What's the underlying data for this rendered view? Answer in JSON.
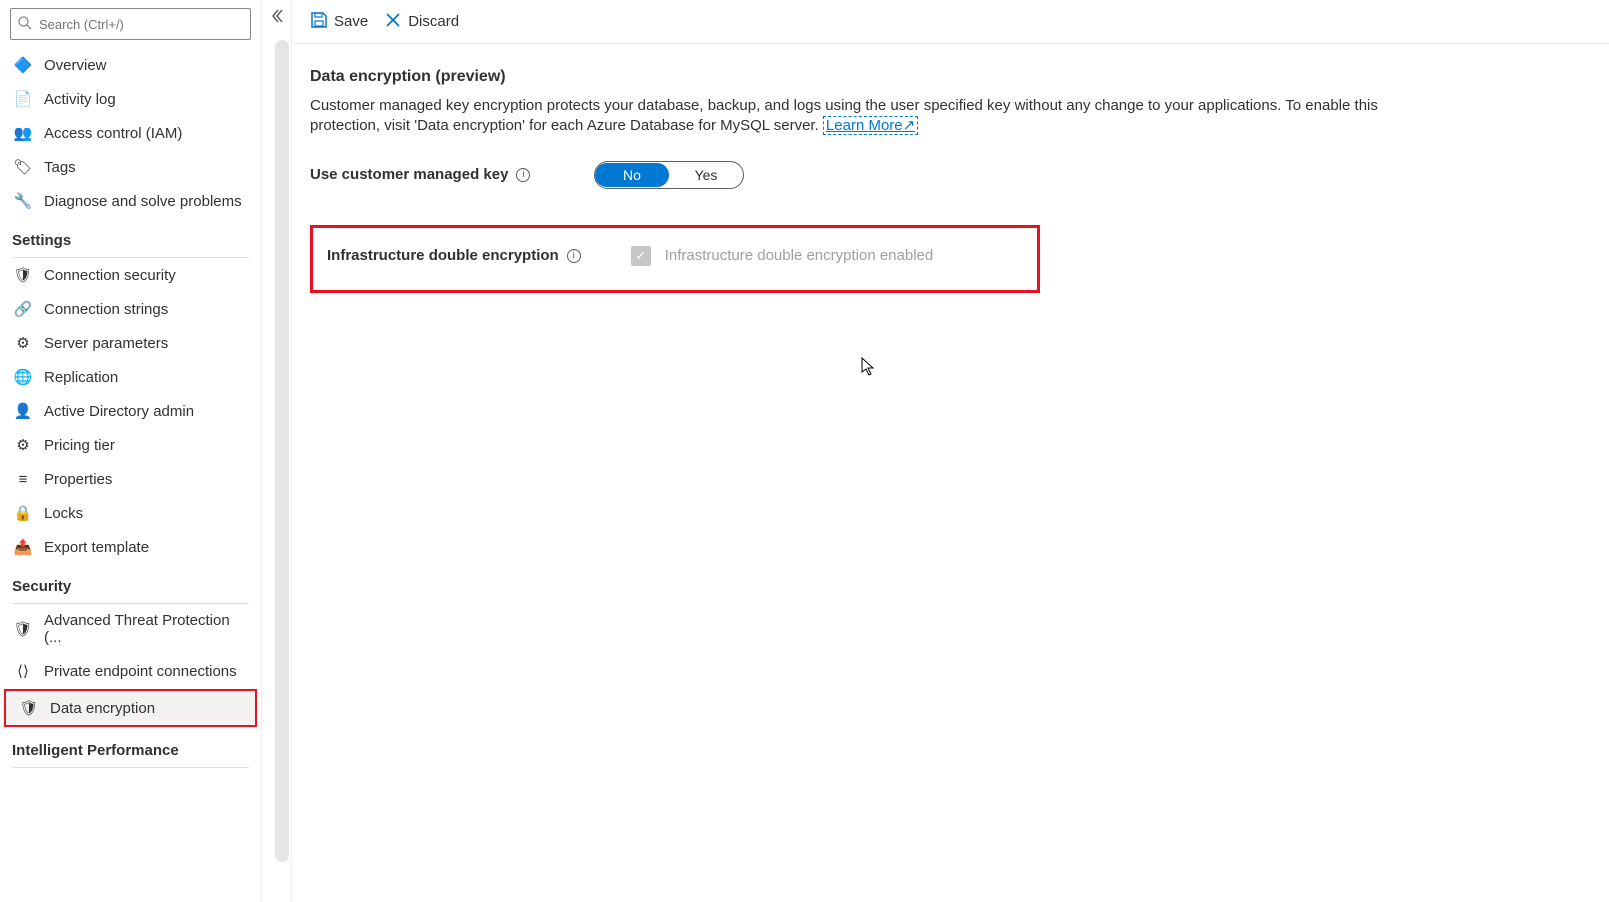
{
  "search": {
    "placeholder": "Search (Ctrl+/)"
  },
  "nav_top": [
    {
      "id": "overview",
      "label": "Overview",
      "icon": "🔷"
    },
    {
      "id": "activity-log",
      "label": "Activity log",
      "icon": "📄"
    },
    {
      "id": "access-control",
      "label": "Access control (IAM)",
      "icon": "👥"
    },
    {
      "id": "tags",
      "label": "Tags",
      "icon": "🏷"
    },
    {
      "id": "diagnose",
      "label": "Diagnose and solve problems",
      "icon": "🔧"
    }
  ],
  "sections": [
    {
      "title": "Settings",
      "items": [
        {
          "id": "connection-security",
          "label": "Connection security",
          "icon": "🛡"
        },
        {
          "id": "connection-strings",
          "label": "Connection strings",
          "icon": "🔗"
        },
        {
          "id": "server-parameters",
          "label": "Server parameters",
          "icon": "⚙"
        },
        {
          "id": "replication",
          "label": "Replication",
          "icon": "🌐"
        },
        {
          "id": "ad-admin",
          "label": "Active Directory admin",
          "icon": "👤"
        },
        {
          "id": "pricing-tier",
          "label": "Pricing tier",
          "icon": "⚙"
        },
        {
          "id": "properties",
          "label": "Properties",
          "icon": "≡"
        },
        {
          "id": "locks",
          "label": "Locks",
          "icon": "🔒"
        },
        {
          "id": "export-template",
          "label": "Export template",
          "icon": "📤"
        }
      ]
    },
    {
      "title": "Security",
      "items": [
        {
          "id": "atp",
          "label": "Advanced Threat Protection (...",
          "icon": "🛡"
        },
        {
          "id": "private-endpoint",
          "label": "Private endpoint connections",
          "icon": "⟨⟩"
        },
        {
          "id": "data-encryption",
          "label": "Data encryption",
          "icon": "🛡",
          "selected": true,
          "highlight": true
        }
      ]
    },
    {
      "title": "Intelligent Performance",
      "items": []
    }
  ],
  "toolbar": {
    "save_label": "Save",
    "discard_label": "Discard"
  },
  "page": {
    "title": "Data encryption (preview)",
    "description_1": "Customer managed key encryption protects your database, backup, and logs using the user specified key without any change to your applications. To enable this protection, visit 'Data encryption' for each Azure Database for MySQL server. ",
    "learn_more": "Learn More",
    "cmk_label": "Use customer managed key",
    "toggle": {
      "no": "No",
      "yes": "Yes",
      "selected": "No"
    },
    "ide_label": "Infrastructure double encryption",
    "ide_checkbox_label": "Infrastructure double encryption enabled"
  }
}
